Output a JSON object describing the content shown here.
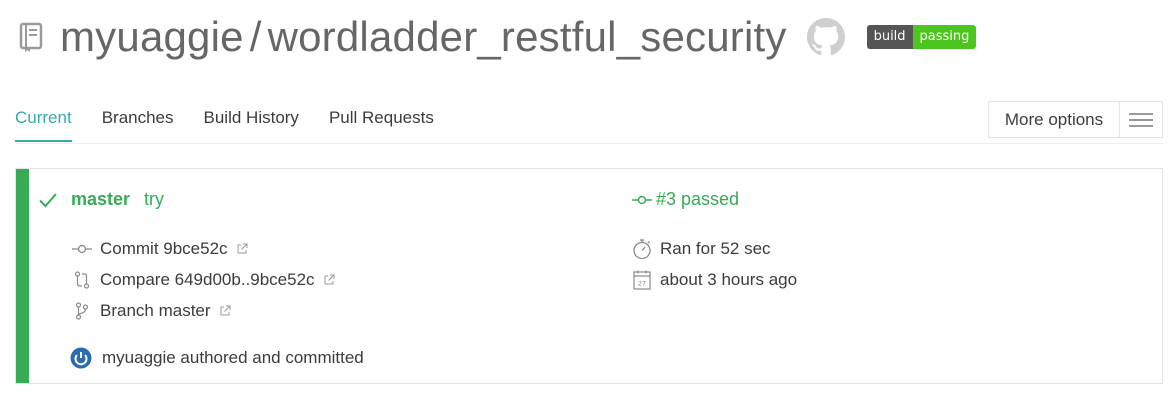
{
  "repo": {
    "owner": "myuaggie",
    "separator": "/",
    "name": "wordladder_restful_security",
    "badge_left": "build",
    "badge_right": "passing"
  },
  "tabs": [
    {
      "label": "Current",
      "active": true
    },
    {
      "label": "Branches"
    },
    {
      "label": "Build History"
    },
    {
      "label": "Pull Requests"
    }
  ],
  "options": {
    "label": "More options"
  },
  "build": {
    "branch": "master",
    "message": "try",
    "status": "#3 passed",
    "commit": "Commit 9bce52c",
    "compare": "Compare 649d00b..9bce52c",
    "branch_link": "Branch master",
    "duration": "Ran for 52 sec",
    "finished": "about 3 hours ago",
    "calendar_day": "27",
    "author": "myuaggie authored and committed"
  },
  "colors": {
    "accent": "#39aaa8",
    "passed": "#39aa56",
    "badge_passing": "#4cc61e",
    "badge_build": "#555555"
  },
  "icons": [
    "repo-icon",
    "github-icon",
    "check-icon",
    "commit-icon",
    "compare-icon",
    "branch-icon",
    "stopwatch-icon",
    "calendar-icon",
    "external-link-icon",
    "avatar-icon",
    "hamburger-icon"
  ]
}
